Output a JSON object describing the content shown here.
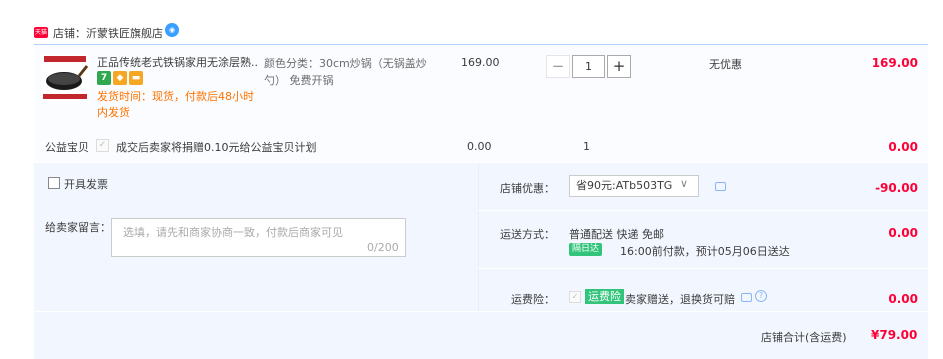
{
  "shop": {
    "badge": "天猫",
    "name": "店铺：沂蒙铁匠旗舰店",
    "ww_icon": "wangwang-chat-icon"
  },
  "product": {
    "title": "正品传统老式铁锅家用无涂层熟...",
    "sku": "颜色分类：30cm炒锅（无锅盖炒勺） 免费开锅",
    "service_icons": [
      {
        "label": "7",
        "color": "#2fa84f"
      },
      {
        "label": "◆",
        "color": "#f5a623"
      },
      {
        "label": "▬",
        "color": "#f5a623"
      }
    ],
    "ship_time": "发货时间：现货，付款后48小时内发货",
    "unit_price": "169.00",
    "quantity": "1",
    "qty_minus": "−",
    "qty_plus": "+",
    "promo": "无优惠",
    "total": "169.00"
  },
  "charity": {
    "label": "公益宝贝",
    "check": "✓",
    "text": "成交后卖家将捐赠0.10元给公益宝贝计划",
    "price": "0.00",
    "qty": "1",
    "total": "0.00"
  },
  "invoice": {
    "label": "开具发票"
  },
  "message": {
    "label": "给卖家留言：",
    "placeholder": "选填，请先和商家协商一致，付款后商家可见",
    "count": "0/200"
  },
  "coupon": {
    "label": "店铺优惠：",
    "selected": "省90元:ATb503TG",
    "arrow": "∨",
    "amount": "-90.00"
  },
  "shipping": {
    "label": "运送方式：",
    "method": "普通配送 快递 免邮",
    "badge": "隔日达",
    "detail": "16:00前付款，预计05月06日送达",
    "amount": "0.00"
  },
  "insurance": {
    "label": "运费险：",
    "check": "✓",
    "badge": "运费险",
    "text": "卖家赠送，退换货可赔",
    "help": "?",
    "amount": "0.00"
  },
  "summary": {
    "label": "店铺合计(含运费)",
    "amount": "¥79.00"
  },
  "colors": {
    "accent_red": "#ff0036",
    "ship_orange": "#ff7300",
    "badge_green": "#31c47a",
    "panel_blue": "#f2f7ff"
  }
}
